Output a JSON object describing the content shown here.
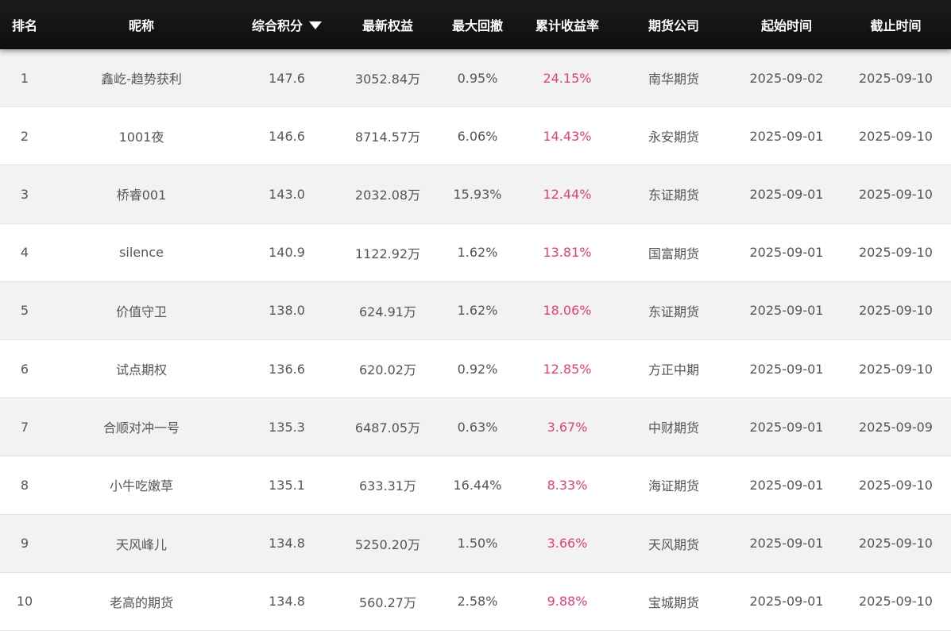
{
  "headers": {
    "rank": "排名",
    "nickname": "昵称",
    "score": "综合积分",
    "equity": "最新权益",
    "drawdown": "最大回撤",
    "return_rate": "累计收益率",
    "company": "期货公司",
    "start": "起始时间",
    "end": "截止时间"
  },
  "icons": {
    "sort": "sort-down-icon"
  },
  "colors": {
    "header_bg": "#111111",
    "return_rate": "#e0407a",
    "row_alt": "#f2f2f2"
  },
  "rows": [
    {
      "rank": "1",
      "nickname": "鑫屹-趋势获利",
      "score": "147.6",
      "equity": "3052.84万",
      "drawdown": "0.95%",
      "return_rate": "24.15%",
      "company": "南华期货",
      "start": "2025-09-02",
      "end": "2025-09-10"
    },
    {
      "rank": "2",
      "nickname": "1001夜",
      "score": "146.6",
      "equity": "8714.57万",
      "drawdown": "6.06%",
      "return_rate": "14.43%",
      "company": "永安期货",
      "start": "2025-09-01",
      "end": "2025-09-10"
    },
    {
      "rank": "3",
      "nickname": "桥睿001",
      "score": "143.0",
      "equity": "2032.08万",
      "drawdown": "15.93%",
      "return_rate": "12.44%",
      "company": "东证期货",
      "start": "2025-09-01",
      "end": "2025-09-10"
    },
    {
      "rank": "4",
      "nickname": "silence",
      "score": "140.9",
      "equity": "1122.92万",
      "drawdown": "1.62%",
      "return_rate": "13.81%",
      "company": "国富期货",
      "start": "2025-09-01",
      "end": "2025-09-10"
    },
    {
      "rank": "5",
      "nickname": "价值守卫",
      "score": "138.0",
      "equity": "624.91万",
      "drawdown": "1.62%",
      "return_rate": "18.06%",
      "company": "东证期货",
      "start": "2025-09-01",
      "end": "2025-09-10"
    },
    {
      "rank": "6",
      "nickname": "试点期权",
      "score": "136.6",
      "equity": "620.02万",
      "drawdown": "0.92%",
      "return_rate": "12.85%",
      "company": "方正中期",
      "start": "2025-09-01",
      "end": "2025-09-10"
    },
    {
      "rank": "7",
      "nickname": "合顺对冲一号",
      "score": "135.3",
      "equity": "6487.05万",
      "drawdown": "0.63%",
      "return_rate": "3.67%",
      "company": "中财期货",
      "start": "2025-09-01",
      "end": "2025-09-09"
    },
    {
      "rank": "8",
      "nickname": "小牛吃嫩草",
      "score": "135.1",
      "equity": "633.31万",
      "drawdown": "16.44%",
      "return_rate": "8.33%",
      "company": "海证期货",
      "start": "2025-09-01",
      "end": "2025-09-10"
    },
    {
      "rank": "9",
      "nickname": "天风峰儿",
      "score": "134.8",
      "equity": "5250.20万",
      "drawdown": "1.50%",
      "return_rate": "3.66%",
      "company": "天风期货",
      "start": "2025-09-01",
      "end": "2025-09-10"
    },
    {
      "rank": "10",
      "nickname": "老高的期货",
      "score": "134.8",
      "equity": "560.27万",
      "drawdown": "2.58%",
      "return_rate": "9.88%",
      "company": "宝城期货",
      "start": "2025-09-01",
      "end": "2025-09-10"
    }
  ]
}
